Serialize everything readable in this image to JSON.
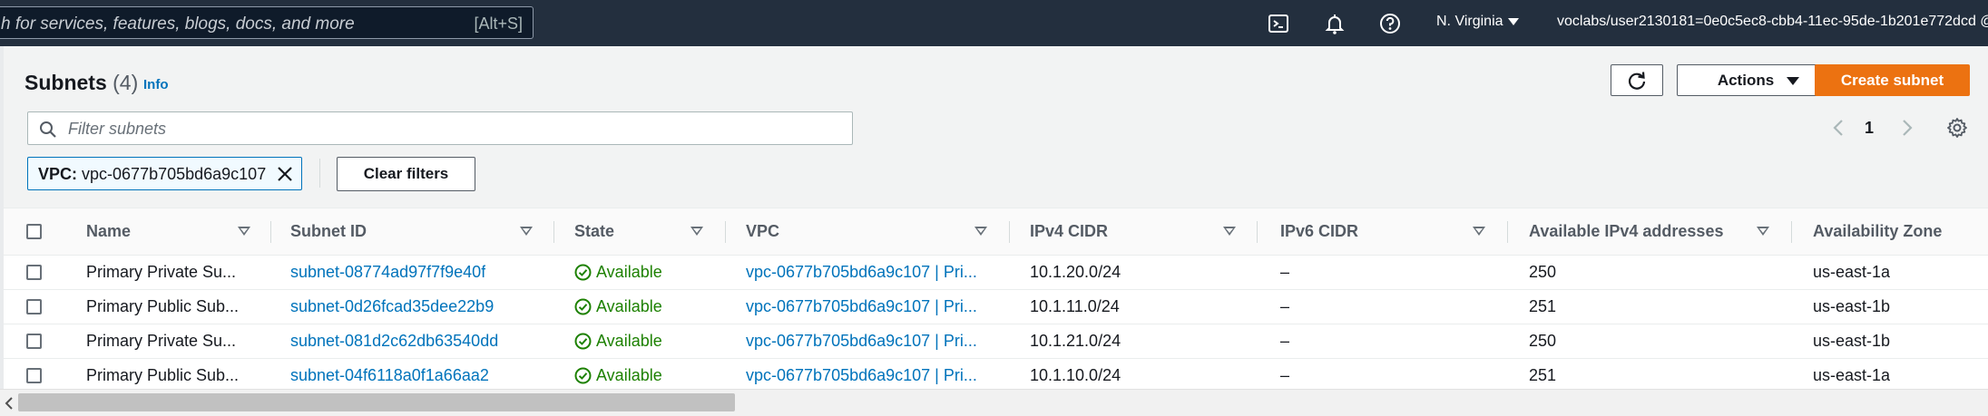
{
  "topbar": {
    "search_placeholder": "h for services, features, blogs, docs, and more",
    "search_shortcut": "[Alt+S]",
    "icons": [
      "cloudshell-icon",
      "bell-icon",
      "help-icon"
    ],
    "region": "N. Virginia",
    "account": "voclabs/user2130181=0e0c5ec8-cbb4-11ec-95de-1b201e772dcd @"
  },
  "header": {
    "title": "Subnets",
    "count": "(4)",
    "info": "Info",
    "actions_label": "Actions",
    "create_label": "Create subnet"
  },
  "filter": {
    "placeholder": "Filter subnets",
    "token_key": "VPC:",
    "token_value": "vpc-0677b705bd6a9c107",
    "clear_label": "Clear filters"
  },
  "pagination": {
    "page": "1"
  },
  "table": {
    "columns": [
      "Name",
      "Subnet ID",
      "State",
      "VPC",
      "IPv4 CIDR",
      "IPv6 CIDR",
      "Available IPv4 addresses",
      "Availability Zone"
    ],
    "rows": [
      {
        "name": "Primary Private Su...",
        "subnet_id": "subnet-08774ad97f7f9e40f",
        "state": "Available",
        "vpc": "vpc-0677b705bd6a9c107 | Pri...",
        "ipv4": "10.1.20.0/24",
        "ipv6": "–",
        "available": "250",
        "az": "us-east-1a"
      },
      {
        "name": "Primary Public Sub...",
        "subnet_id": "subnet-0d26fcad35dee22b9",
        "state": "Available",
        "vpc": "vpc-0677b705bd6a9c107 | Pri...",
        "ipv4": "10.1.11.0/24",
        "ipv6": "–",
        "available": "251",
        "az": "us-east-1b"
      },
      {
        "name": "Primary Private Su...",
        "subnet_id": "subnet-081d2c62db63540dd",
        "state": "Available",
        "vpc": "vpc-0677b705bd6a9c107 | Pri...",
        "ipv4": "10.1.21.0/24",
        "ipv6": "–",
        "available": "250",
        "az": "us-east-1b"
      },
      {
        "name": "Primary Public Sub...",
        "subnet_id": "subnet-04f6118a0f1a66aa2",
        "state": "Available",
        "vpc": "vpc-0677b705bd6a9c107 | Pri...",
        "ipv4": "10.1.10.0/24",
        "ipv6": "–",
        "available": "251",
        "az": "us-east-1a"
      }
    ]
  },
  "colors": {
    "nav_bg": "#232f3e",
    "primary_button": "#ec7211",
    "link": "#0073bb",
    "available": "#1d8102"
  }
}
